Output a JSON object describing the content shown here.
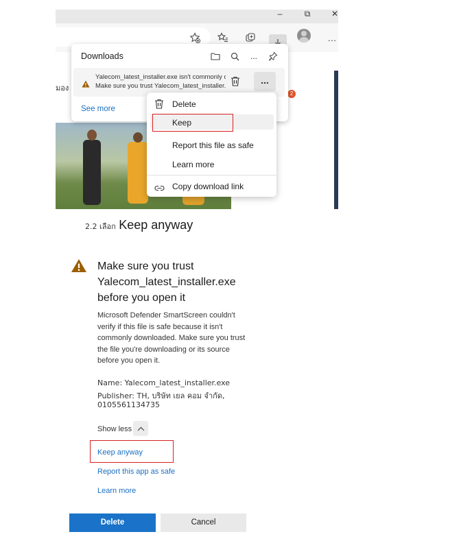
{
  "window": {
    "minimize": "–",
    "restore": "⧉",
    "close": "✕"
  },
  "toolbar": {
    "more": "…"
  },
  "background": {
    "cut_text": "มอง",
    "badge": "2"
  },
  "downloads": {
    "title": "Downloads",
    "more": "...",
    "item": {
      "line1": "Yalecom_latest_installer.exe isn't commonly downloaded.",
      "line2": "Make sure you trust Yalecom_latest_installer.exe before you open it."
    },
    "see_more": "See more"
  },
  "context_menu": {
    "items": [
      {
        "label": "Delete",
        "icon": "trash-icon"
      },
      {
        "label": "Keep",
        "icon": ""
      },
      {
        "label": "Report this file as safe",
        "icon": ""
      },
      {
        "label": "Learn more",
        "icon": ""
      },
      {
        "label": "Copy download link",
        "icon": "link-icon"
      }
    ]
  },
  "caption": {
    "step": "2.2 เลือก",
    "action": "Keep anyway"
  },
  "smartscreen": {
    "title_lines": [
      "Make sure you trust",
      "Yalecom_latest_installer.exe",
      "before you open it"
    ],
    "body": "Microsoft Defender SmartScreen couldn't verify if this file is safe because it isn't commonly downloaded. Make sure you trust the file you're downloading or its source before you open it.",
    "name_line": "Name: Yalecom_latest_installer.exe",
    "publisher_line": "Publisher: TH, บริษัท เยล คอม จำกัด,",
    "publisher_id": "0105561134735",
    "show_less": "Show less",
    "keep_anyway": "Keep anyway",
    "report_safe": "Report this app as safe",
    "learn_more": "Learn more",
    "delete": "Delete",
    "cancel": "Cancel"
  },
  "colors": {
    "accent": "#1a73c8",
    "link": "#1a6fc2",
    "highlight": "#d82020",
    "warning": "#9c5f00"
  }
}
